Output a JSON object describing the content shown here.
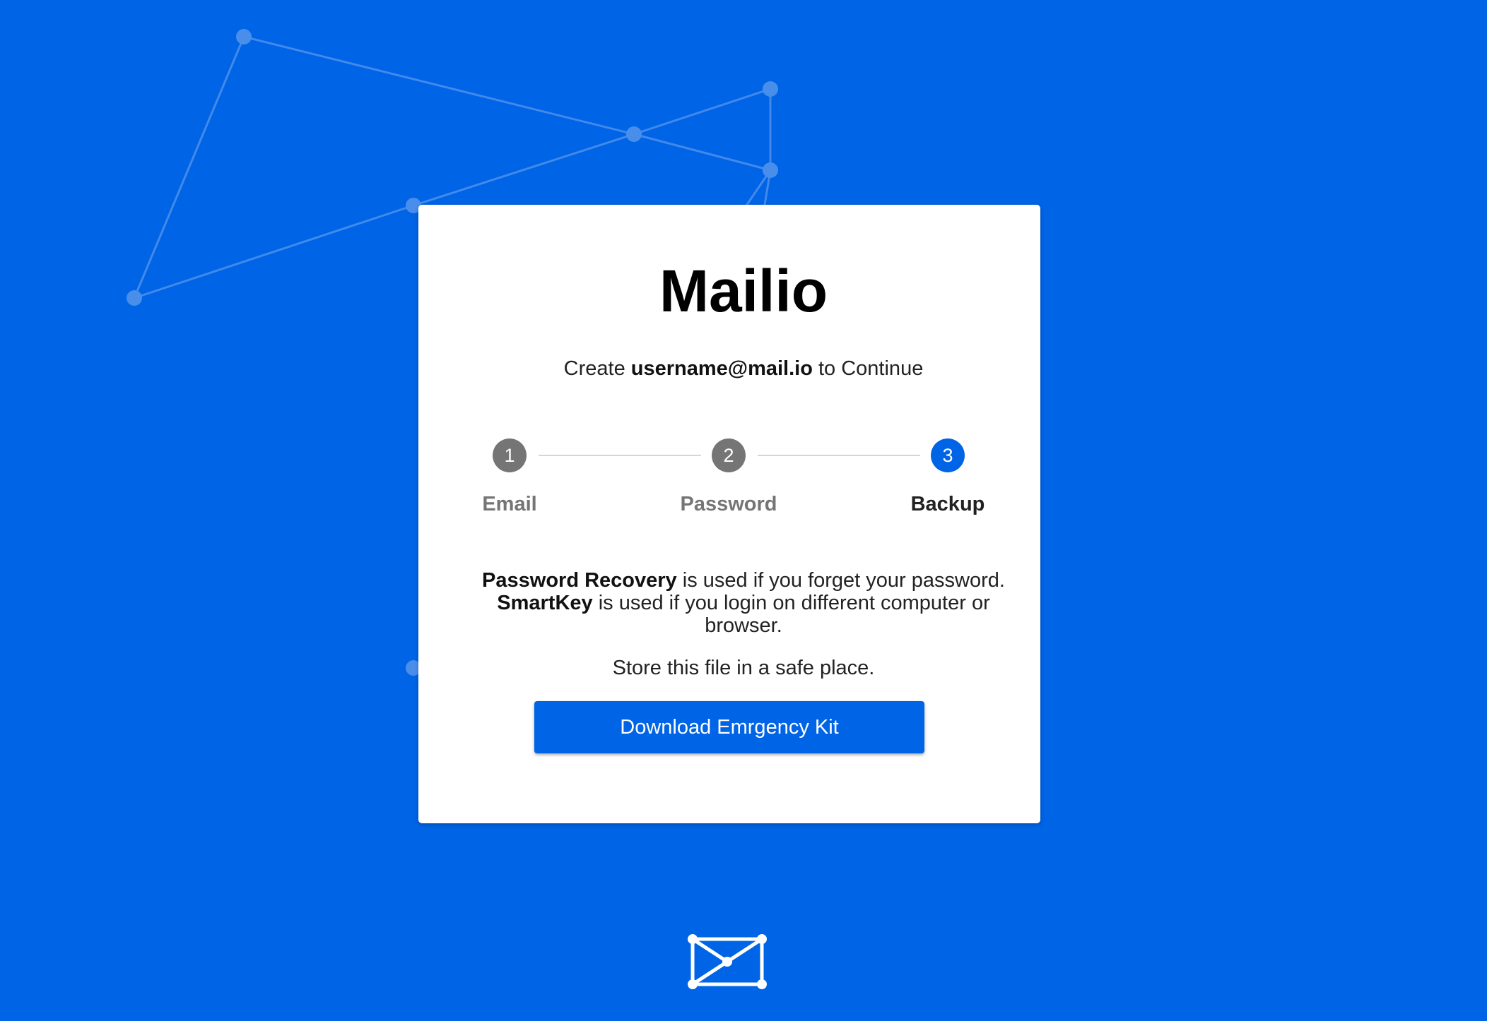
{
  "app": {
    "title": "Mailio",
    "subtitle_prefix": "Create ",
    "subtitle_email": "username@mail.io",
    "subtitle_suffix": " to Continue"
  },
  "stepper": {
    "steps": [
      {
        "number": "1",
        "label": "Email",
        "state": "completed"
      },
      {
        "number": "2",
        "label": "Password",
        "state": "completed"
      },
      {
        "number": "3",
        "label": "Backup",
        "state": "active"
      }
    ]
  },
  "backup_info": {
    "recovery_term": "Password Recovery",
    "recovery_text": " is used if you forget your password.",
    "smartkey_term": "SmartKey",
    "smartkey_text": " is used if you login on different computer or",
    "smartkey_text_2": "browser.",
    "store_note": "Store this file in a safe place."
  },
  "actions": {
    "download_label": "Download Emrgency Kit"
  },
  "icons": {
    "footer_logo": "mailio-envelope-logo-icon",
    "background": "network-constellation-icon"
  },
  "colors": {
    "background": "#0064e6",
    "primary": "#0064e6",
    "step_inactive": "#757575",
    "card": "#ffffff"
  }
}
